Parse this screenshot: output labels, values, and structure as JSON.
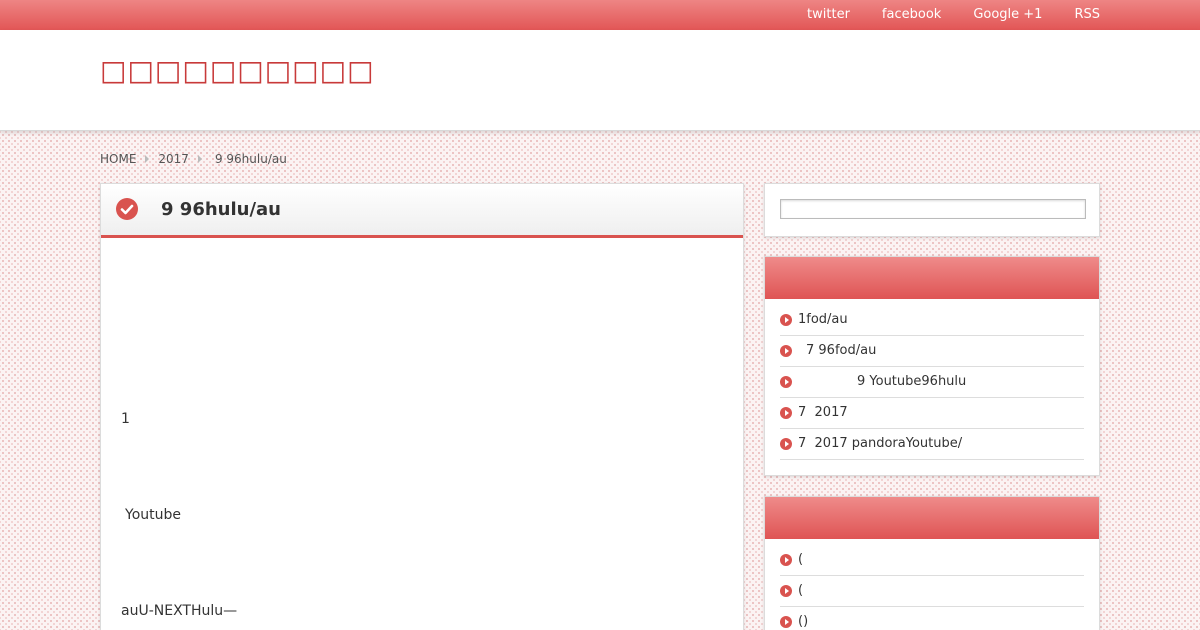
{
  "topnav": [
    "twitter",
    "facebook",
    "Google +1",
    "RSS"
  ],
  "site": {
    "title": "□□□□□□□□□□"
  },
  "breadcrumb": [
    "HOME",
    "2017",
    "9 96hulu/au"
  ],
  "post": {
    "title": "9 96hulu/au",
    "paragraphs": [
      "1",
      "Youtube",
      "auU-NEXTHulu—"
    ]
  },
  "search": {
    "value": ""
  },
  "widgets": [
    {
      "items": [
        "1fod/au",
        "7 96fod/au",
        "9 Youtube96hulu",
        "7  2017",
        "7  2017 pandoraYoutube/"
      ]
    },
    {
      "items": [
        "(",
        "(",
        "()"
      ]
    }
  ],
  "colors": {
    "accent": "#d9534f",
    "title": "#c83a3a"
  }
}
